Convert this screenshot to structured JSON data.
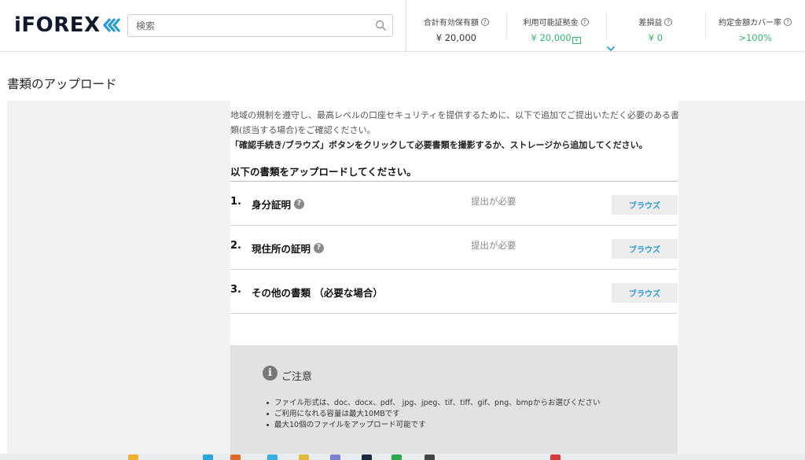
{
  "header": {
    "logo_text": "iFOREX",
    "search_placeholder": "検索",
    "stats": [
      {
        "label": "合計有効保有額",
        "value": "¥ 20,000",
        "green": false
      },
      {
        "label": "利用可能証拠金",
        "value": "¥ 20,000",
        "green": true,
        "cash_icon": "cash-icon"
      },
      {
        "label": "差損益",
        "value": "¥ 0",
        "green": true
      },
      {
        "label": "約定金額カバー率",
        "value": ">100%",
        "green": true
      }
    ]
  },
  "page": {
    "title": "書類のアップロード",
    "intro": "地域の規制を遵守し、最高レベルの口座セキュリティを提供するために、以下で追加でご提出いただく必要のある書類(該当する場合)をご確認ください。",
    "intro_bold": "「確認手続き/ブラウズ」ボタンをクリックして必要書類を撮影するか、ストレージから追加してください。",
    "section_heading": "以下の書類をアップロードしてください。",
    "documents": [
      {
        "num": "1.",
        "name": "身分証明",
        "help": true,
        "status": "提出が必要",
        "button": "ブラウズ"
      },
      {
        "num": "2.",
        "name": "現住所の証明",
        "help": true,
        "status": "提出が必要",
        "button": "ブラウズ"
      },
      {
        "num": "3.",
        "name": "その他の書類 （必要な場合）",
        "help": false,
        "status": "",
        "button": "ブラウズ"
      }
    ],
    "notice": {
      "title": "ご注意",
      "items": [
        "ファイル形式は、doc、docx、pdf、 jpg、jpeg、tif、tiff、gif、png、bmpからお選びください",
        "ご利用になれる容量は最大10MBです",
        "最大10個のファイルをアップロード可能です"
      ]
    }
  },
  "colors": {
    "accent_blue": "#2a9bd6",
    "positive_green": "#2eb86e",
    "logo_chevron": "#2a9bd6"
  }
}
